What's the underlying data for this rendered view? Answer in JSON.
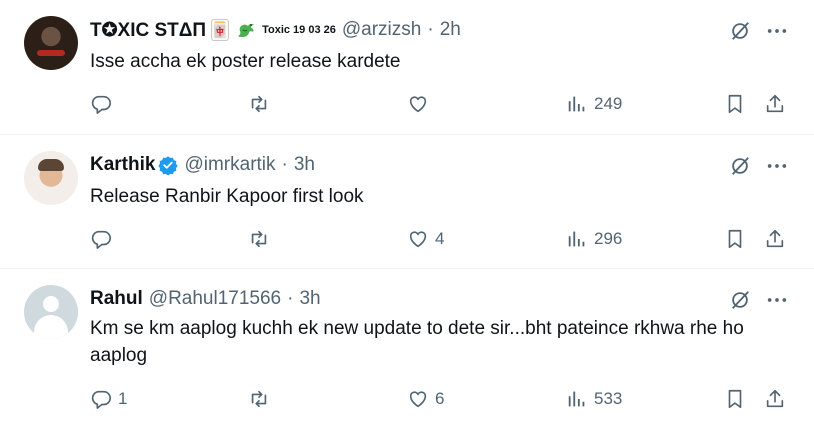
{
  "replies": [
    {
      "name": "T✪XIC STΔП",
      "name_tag": "Toxic 19 03 26",
      "mahjong": "🀄",
      "handle": "@arzizsh",
      "time": "2h",
      "text": "Isse accha ek poster release kardete",
      "reply_count": "",
      "like_count": "",
      "views": "249",
      "verified": false
    },
    {
      "name": "Karthik",
      "handle": "@imrkartik",
      "time": "3h",
      "text": "Release Ranbir Kapoor first look",
      "reply_count": "",
      "like_count": "4",
      "views": "296",
      "verified": true
    },
    {
      "name": "Rahul",
      "handle": "@Rahul171566",
      "time": "3h",
      "text": "Km se km aaplog kuchh ek new update to dete sir...bht pateince rkhwa rhe ho aaplog",
      "reply_count": "1",
      "like_count": "6",
      "views": "533",
      "verified": false
    }
  ],
  "separator": "·",
  "colors": {
    "text": "#0f1419",
    "muted": "#536471",
    "verified": "#1d9bf0",
    "border": "#eff3f4"
  },
  "icons": [
    "reply-icon",
    "retweet-icon",
    "heart-icon",
    "views-icon",
    "bookmark-icon",
    "share-icon",
    "grok-icon",
    "more-icon",
    "verified-icon",
    "dragon-icon",
    "mahjong-icon"
  ]
}
